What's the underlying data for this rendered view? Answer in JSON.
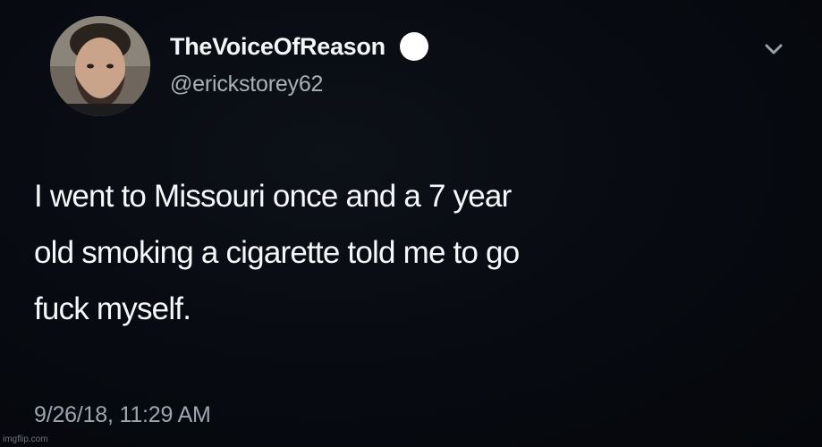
{
  "tweet": {
    "author": {
      "display_name": "TheVoiceOfReason",
      "handle": "@erickstorey62",
      "verified_icon": "verified-badge-icon",
      "avatar_icon": "avatar-photo"
    },
    "menu_icon": "chevron-down-icon",
    "text_lines": [
      "I went to Missouri once and a 7 year",
      "old smoking a cigarette told me to go",
      "fuck myself."
    ],
    "timestamp": "9/26/18, 11:29 AM"
  },
  "watermark": {
    "text": "imgflip.com"
  },
  "colors": {
    "background": "#06080d",
    "text": "#f6f7f9",
    "secondary_text": "#a9b0ba",
    "badge": "#ffffff"
  }
}
